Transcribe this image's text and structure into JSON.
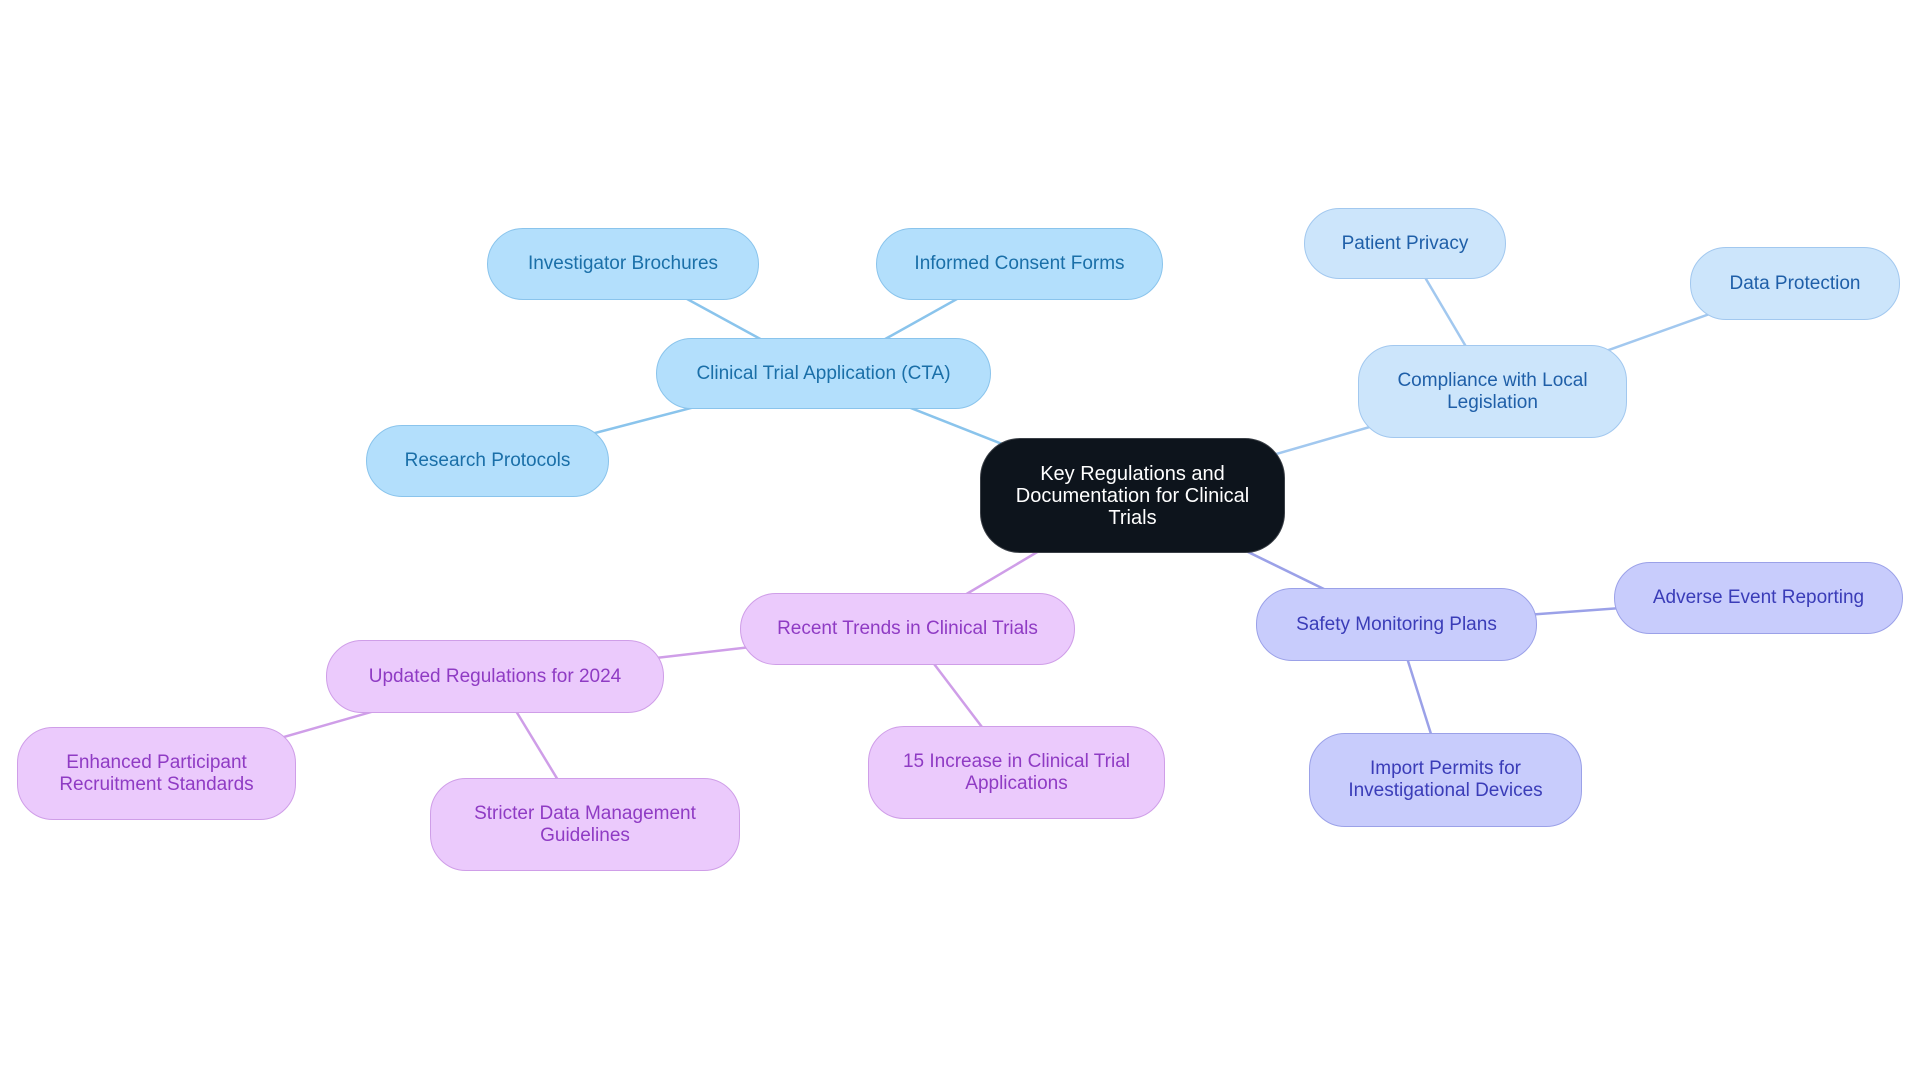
{
  "diagram": {
    "type": "mindmap",
    "root": {
      "id": "root",
      "label": "Key Regulations and Documentation for Clinical Trials"
    },
    "colors": {
      "root_fill": "#0d141c",
      "root_text": "#ffffff",
      "blue": {
        "fill": "#b3dffc",
        "stroke": "#8ac4ec",
        "text": "#1a6fa8"
      },
      "light": {
        "fill": "#cce5fb",
        "stroke": "#a2c8ef",
        "text": "#1f5fa8"
      },
      "indigo": {
        "fill": "#c8ccfc",
        "stroke": "#9ba1e8",
        "text": "#3a3cb8"
      },
      "purple": {
        "fill": "#ebcafc",
        "stroke": "#cf9ee8",
        "text": "#8f3bc4"
      }
    },
    "branches": [
      {
        "id": "cta",
        "label": "Clinical Trial Application (CTA)",
        "group": "blue",
        "children": [
          {
            "id": "ib",
            "label": "Investigator Brochures"
          },
          {
            "id": "icf",
            "label": "Informed Consent Forms"
          },
          {
            "id": "rp",
            "label": "Research Protocols"
          }
        ]
      },
      {
        "id": "cll",
        "label": "Compliance with Local Legislation",
        "group": "light",
        "children": [
          {
            "id": "pp",
            "label": "Patient Privacy"
          },
          {
            "id": "dp",
            "label": "Data Protection"
          }
        ]
      },
      {
        "id": "smp",
        "label": "Safety Monitoring Plans",
        "group": "indigo",
        "children": [
          {
            "id": "aer",
            "label": "Adverse Event Reporting"
          },
          {
            "id": "ipid",
            "label": "Import Permits for Investigational Devices"
          }
        ]
      },
      {
        "id": "rtct",
        "label": "Recent Trends in Clinical Trials",
        "group": "purple",
        "children": [
          {
            "id": "ur24",
            "label": "Updated Regulations for 2024",
            "children": [
              {
                "id": "eprs",
                "label": "Enhanced Participant Recruitment Standards"
              },
              {
                "id": "sdmg",
                "label": "Stricter Data Management Guidelines"
              }
            ]
          },
          {
            "id": "inc15",
            "label": "15 Increase in Clinical Trial Applications"
          }
        ]
      }
    ]
  }
}
